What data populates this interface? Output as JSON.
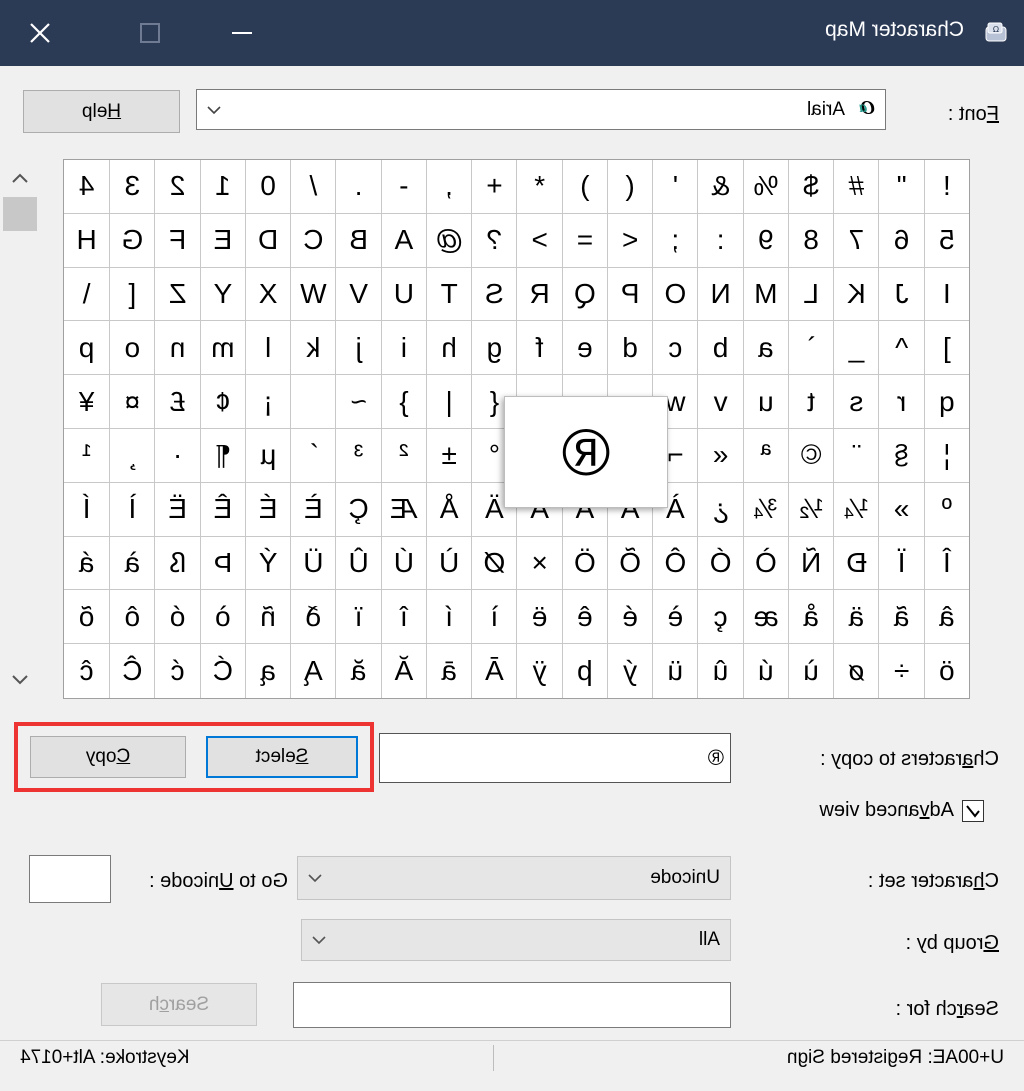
{
  "window": {
    "title": "Character Map",
    "icons": {
      "app": "character-map-app-icon",
      "minimize": "minimize-icon",
      "maximize": "maximize-icon",
      "close": "close-icon"
    }
  },
  "font": {
    "label_prefix": "",
    "label_underlined": "F",
    "label_suffix": "ont :",
    "value": "Arial",
    "font_icon": "opentype-font-icon",
    "help_button": {
      "underlined": "H",
      "rest": "elp"
    }
  },
  "characters": [
    "!",
    "\"",
    "#",
    "$",
    "%",
    "&",
    "'",
    "(",
    ")",
    "*",
    "+",
    ",",
    "-",
    ".",
    "/",
    "0",
    "1",
    "2",
    "3",
    "4",
    "5",
    "6",
    "7",
    "8",
    "9",
    ":",
    ";",
    "<",
    "=",
    ">",
    "?",
    "@",
    "A",
    "B",
    "C",
    "D",
    "E",
    "F",
    "G",
    "H",
    "I",
    "J",
    "K",
    "L",
    "M",
    "N",
    "O",
    "P",
    "Q",
    "R",
    "S",
    "T",
    "U",
    "V",
    "W",
    "X",
    "Y",
    "Z",
    "[",
    "\\",
    "]",
    "^",
    "_",
    "`",
    "a",
    "b",
    "c",
    "d",
    "e",
    "f",
    "g",
    "h",
    "i",
    "j",
    "k",
    "l",
    "m",
    "n",
    "o",
    "p",
    "q",
    "r",
    "s",
    "t",
    "u",
    "v",
    "w",
    "x",
    "y",
    "z",
    "{",
    "|",
    "}",
    "~",
    " ",
    "¡",
    "¢",
    "£",
    "¤",
    "¥",
    "¦",
    "§",
    "¨",
    "©",
    "ª",
    "«",
    "¬",
    "-",
    "®",
    "¯",
    "°",
    "±",
    "²",
    "³",
    "´",
    "µ",
    "¶",
    "·",
    "¸",
    "¹",
    "º",
    "»",
    "¼",
    "½",
    "¾",
    "¿",
    "À",
    "Á",
    "Â",
    "Ã",
    "Ä",
    "Å",
    "Æ",
    "Ç",
    "È",
    "É",
    "Ê",
    "Ë",
    "Ì",
    "Í",
    "Î",
    "Ï",
    "Ð",
    "Ñ",
    "Ò",
    "Ó",
    "Ô",
    "Õ",
    "Ö",
    "×",
    "Ø",
    "Ù",
    "Ú",
    "Û",
    "Ü",
    "Ý",
    "Þ",
    "ß",
    "à",
    "á",
    "â",
    "ã",
    "ä",
    "å",
    "æ",
    "ç",
    "è",
    "é",
    "ê",
    "ë",
    "ì",
    "í",
    "î",
    "ï",
    "ð",
    "ñ",
    "ò",
    "ó",
    "ô",
    "õ",
    "ö",
    "÷",
    "ø",
    "ù",
    "ú",
    "û",
    "ü",
    "ý",
    "þ",
    "ÿ",
    "Ā",
    "ā",
    "Ă",
    "ă",
    "Ą",
    "ą",
    "Ć",
    "ć",
    "Ĉ",
    "ĉ"
  ],
  "enlarged_character": "®",
  "copy_row": {
    "label_prefix": "Ch",
    "label_underlined": "a",
    "label_suffix": "racters to copy :",
    "value": "®",
    "select_button": {
      "underlined": "S",
      "rest": "elect"
    },
    "copy_button": {
      "underlined": "C",
      "rest": "opy"
    }
  },
  "advanced_view": {
    "prefix": "Ad",
    "underlined": "v",
    "suffix": "anced view",
    "checked": true
  },
  "character_set": {
    "prefix": "C",
    "underlined": "h",
    "suffix": "aracter set :",
    "value": "Unicode"
  },
  "goto_unicode": {
    "prefix": "Go to ",
    "underlined": "U",
    "suffix": "nicode :",
    "value": ""
  },
  "group_by": {
    "prefix": "",
    "underlined": "G",
    "suffix": "roup by :",
    "value": "All"
  },
  "search": {
    "prefix": "Sea",
    "underlined": "r",
    "suffix": "ch for :",
    "value": "",
    "button": {
      "prefix": "Sear",
      "underlined": "c",
      "suffix": "h"
    }
  },
  "status": {
    "description": "U+00AE: Registered Sign",
    "keystroke": "Keystroke: Alt+0174"
  }
}
